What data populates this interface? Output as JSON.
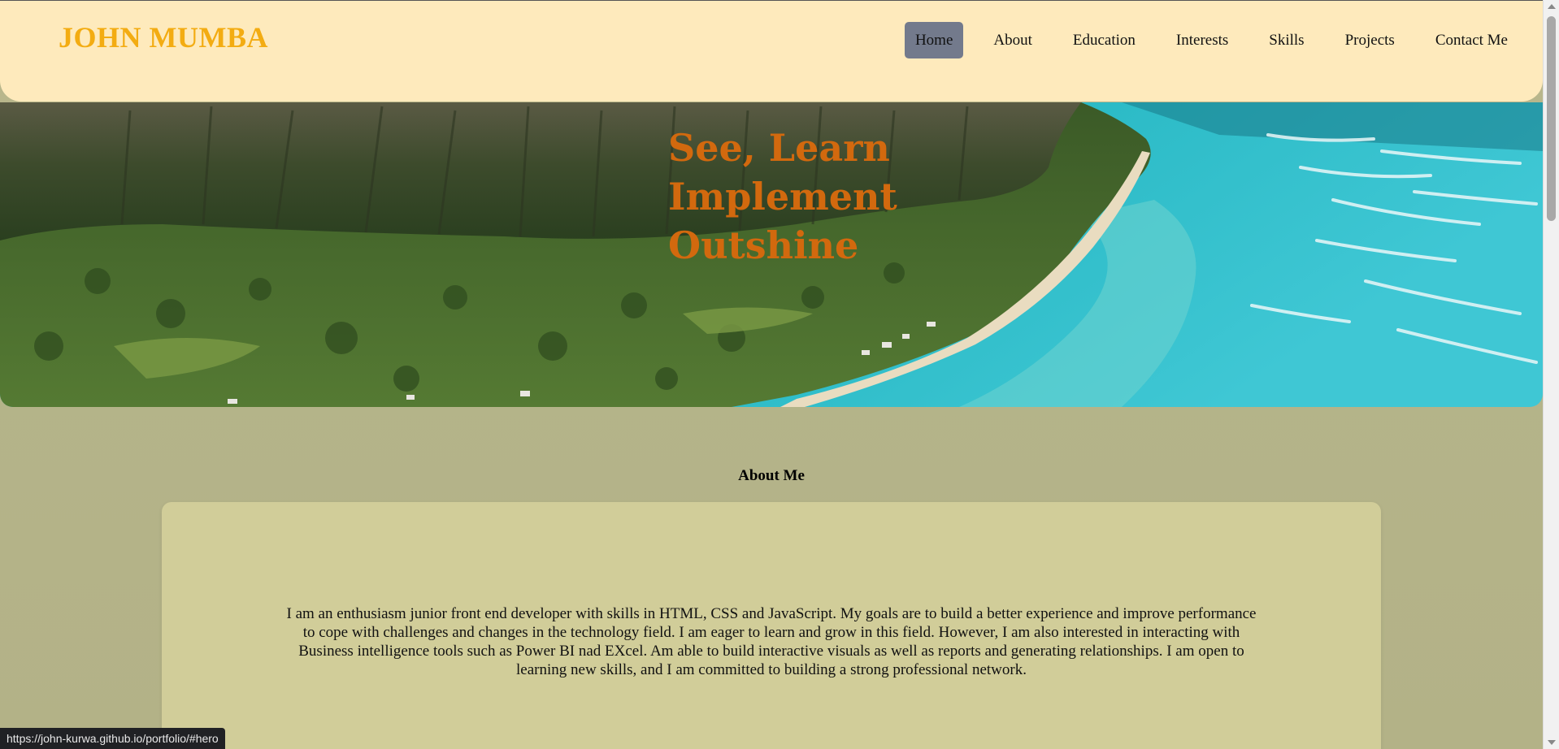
{
  "header": {
    "brand": "JOHN MUMBA",
    "nav": [
      {
        "label": "Home",
        "active": true
      },
      {
        "label": "About",
        "active": false
      },
      {
        "label": "Education",
        "active": false
      },
      {
        "label": "Interests",
        "active": false
      },
      {
        "label": "Skills",
        "active": false
      },
      {
        "label": "Projects",
        "active": false
      },
      {
        "label": "Contact Me",
        "active": false
      }
    ]
  },
  "hero": {
    "lines": [
      "See, Learn",
      "Implement",
      "Outshine"
    ],
    "image": "coastal-mountain-aerial-photo"
  },
  "about": {
    "title": "About Me",
    "text": "I am an enthusiasm junior front end developer with skills in HTML, CSS and JavaScript. My goals are to build a better experience and improve performance to cope with challenges and changes in the technology field. I am eager to learn and grow in this field. However, I am also interested in interacting with Business intelligence tools such as Power BI nad EXcel. Am able to build interactive visuals as well as reports and generating relationships. I am open to learning new skills, and I am committed to building a strong professional network."
  },
  "status_bar": {
    "url": "https://john-kurwa.github.io/portfolio/#hero"
  },
  "colors": {
    "brand": "#f3ac12",
    "header_bg": "#feeabc",
    "hero_text": "#d2690e",
    "nav_active": "#737a8c",
    "page_bg": "#b9b78c",
    "card_bg": "#d1cd99"
  }
}
